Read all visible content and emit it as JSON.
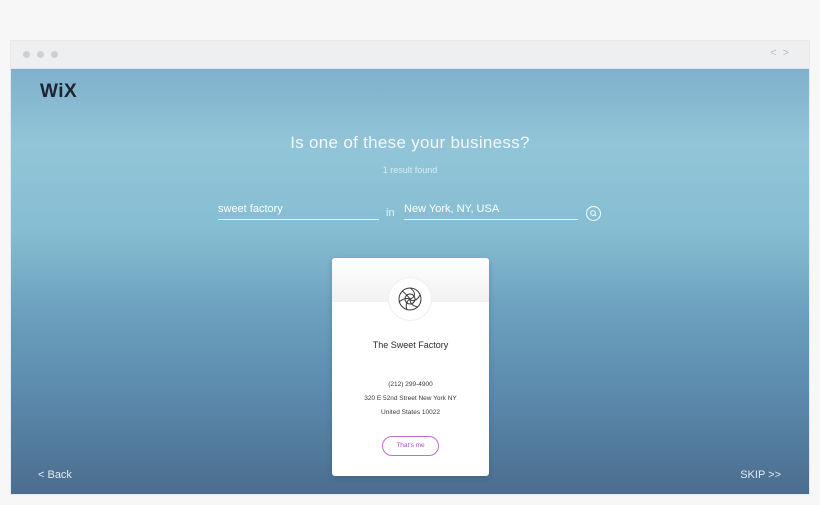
{
  "window": {
    "nav_back_glyph": "<",
    "nav_forward_glyph": ">"
  },
  "brand": {
    "logo_text": "WiX"
  },
  "heading": {
    "title": "Is one of these your business?",
    "result_count": "1 result found"
  },
  "search": {
    "business_value": "sweet factory",
    "in_label": "in",
    "location_value": "New York, NY, USA",
    "button_icon": "search-icon"
  },
  "result": {
    "logo_icon": "spiral-logo-icon",
    "name": "The Sweet Factory",
    "phone": "(212) 299-4900",
    "address_line1": "320 E 52nd Street New York NY",
    "address_line2": "United States 10022",
    "confirm_label": "That's me",
    "confirm_color": "#b04cc4"
  },
  "footer": {
    "back_label": "< Back",
    "skip_label": "SKIP >>"
  },
  "colors": {
    "gradient_top": "#92c5d8",
    "gradient_bottom": "#4b6d8f",
    "logo": "#1c2331"
  }
}
